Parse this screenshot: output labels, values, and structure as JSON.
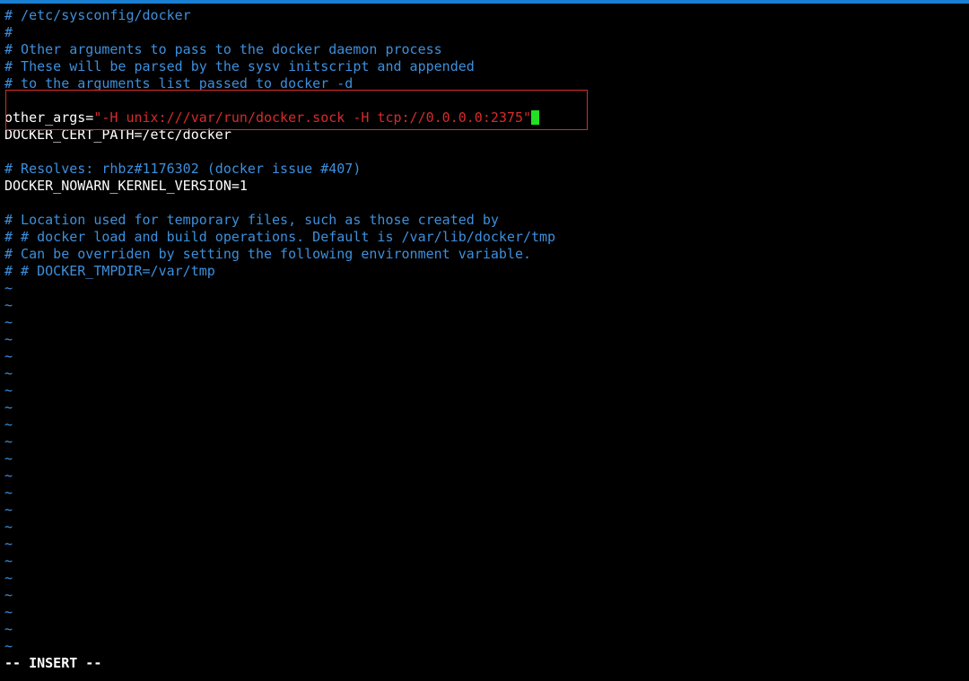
{
  "editor": {
    "lines": {
      "l0": "# /etc/sysconfig/docker",
      "l1": "#",
      "l2": "# Other arguments to pass to the docker daemon process",
      "l3": "# These will be parsed by the sysv initscript and appended",
      "l4": "# to the arguments list passed to docker -d",
      "l5": "",
      "l6_key": "other_args=",
      "l6_value": "\"-H unix:///var/run/docker.sock -H tcp://0.0.0.0:2375\"",
      "l7": "DOCKER_CERT_PATH=/etc/docker",
      "l8": "",
      "l9": "# Resolves: rhbz#1176302 (docker issue #407)",
      "l10": "DOCKER_NOWARN_KERNEL_VERSION=1",
      "l11": "",
      "l12": "# Location used for temporary files, such as those created by",
      "l13": "# # docker load and build operations. Default is /var/lib/docker/tmp",
      "l14": "# Can be overriden by setting the following environment variable.",
      "l15": "# # DOCKER_TMPDIR=/var/tmp"
    },
    "empty_line_marker": "~",
    "empty_line_count": 22
  },
  "status": {
    "mode": "-- INSERT --"
  },
  "colors": {
    "comment": "#3d8fdc",
    "string": "#d62b2b",
    "cursor": "#22e022",
    "highlight_box": "#d62b2b",
    "top_border": "#1a7fd1"
  }
}
